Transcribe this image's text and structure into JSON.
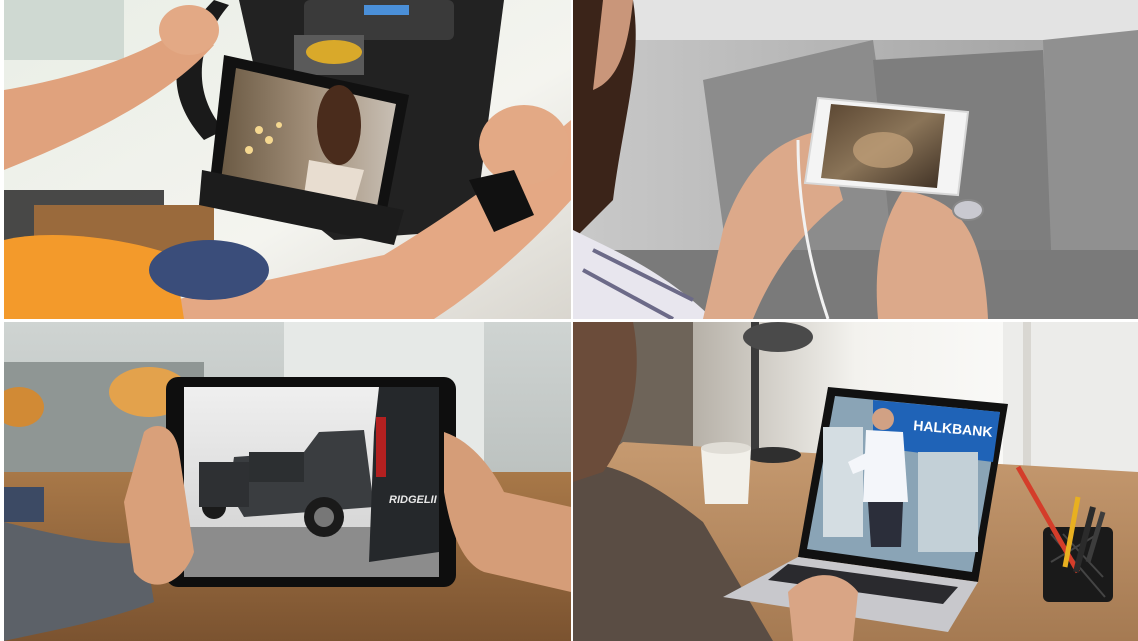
{
  "panels": [
    {
      "id": "p1",
      "scene": "exercise-bike-tablet"
    },
    {
      "id": "p2",
      "scene": "sofa-phone"
    },
    {
      "id": "p3",
      "scene": "desk-tablet-truck"
    },
    {
      "id": "p4",
      "scene": "desk-laptop-bank"
    }
  ],
  "texts": {
    "truck_badge": "RIDGELII",
    "bank_sign": "HALKBANK"
  },
  "colors": {
    "background": "#ffffff",
    "bank_blue": "#1f63b7",
    "orange_shirt": "#f39a2b"
  }
}
